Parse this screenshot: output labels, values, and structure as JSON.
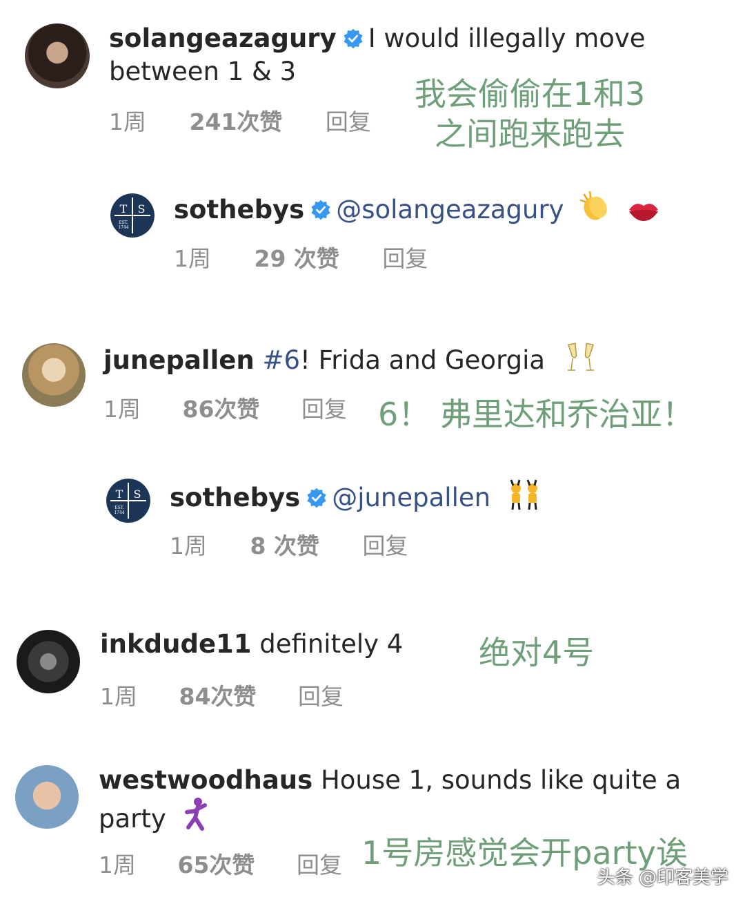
{
  "comments": [
    {
      "username": "solangeazagury",
      "text_line1": "I would illegally move",
      "text_line2": "between 1 & 3",
      "time": "1周",
      "likes": "241次赞",
      "reply": "回复",
      "annotation_line1": "我会偷偷在1和3",
      "annotation_line2": "之间跑来跑去"
    },
    {
      "username": "sothebys",
      "mention": "@solangeazagury",
      "time": "1周",
      "likes": "29 次赞",
      "reply": "回复",
      "emojis": [
        "clapping-hands",
        "kiss-mark"
      ]
    },
    {
      "username": "junepallen",
      "hashtag": "#6",
      "text": "! Frida and Georgia",
      "time": "1周",
      "likes": "86次赞",
      "reply": "回复",
      "annotation": "6！ 弗里达和乔治亚！",
      "emojis": [
        "clinking-glasses"
      ]
    },
    {
      "username": "sothebys",
      "mention": "@junepallen",
      "time": "1周",
      "likes": "8 次赞",
      "reply": "回复",
      "emojis": [
        "people-with-bunny-ears"
      ]
    },
    {
      "username": "inkdude11",
      "text": "definitely 4",
      "time": "1周",
      "likes": "84次赞",
      "reply": "回复",
      "annotation": "绝对4号"
    },
    {
      "username": "westwoodhaus",
      "text_line1": "House 1, sounds like quite a",
      "text_line2": "party",
      "time": "1周",
      "likes": "65次赞",
      "reply": "回复",
      "annotation": "1号房感觉会开party诶",
      "emojis": [
        "man-dancing"
      ]
    }
  ],
  "logo": {
    "left": "T",
    "right": "S",
    "est": "EST.",
    "year": "1744"
  },
  "watermark": "头条 @印客美学",
  "colors": {
    "annotation": "#6e9f78",
    "verified": "#3897f0",
    "mention": "#385185",
    "meta": "#8e8e8e"
  }
}
